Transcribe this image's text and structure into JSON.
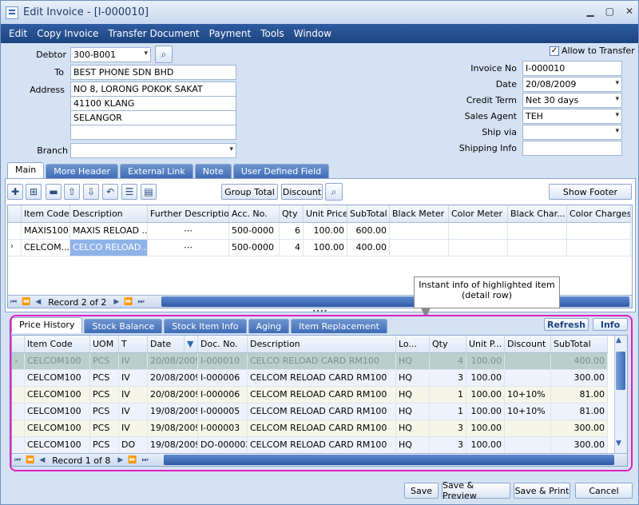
{
  "window": {
    "title": "Edit Invoice - [I-000010]"
  },
  "menu": [
    "Edit",
    "Copy Invoice",
    "Transfer Document",
    "Payment",
    "Tools",
    "Window"
  ],
  "header": {
    "debtor_label": "Debtor",
    "debtor": "300-B001",
    "to_label": "To",
    "to": "BEST PHONE SDN BHD",
    "address_label": "Address",
    "address": [
      "NO 8, LORONG POKOK SAKAT",
      "41100 KLANG",
      "SELANGOR",
      ""
    ],
    "branch_label": "Branch",
    "branch": "",
    "allow_transfer": "Allow to Transfer",
    "invoice_no_label": "Invoice No",
    "invoice_no": "I-000010",
    "date_label": "Date",
    "date": "20/08/2009",
    "credit_term_label": "Credit Term",
    "credit_term": "Net 30 days",
    "sales_agent_label": "Sales Agent",
    "sales_agent": "TEH",
    "ship_via_label": "Ship via",
    "ship_via": "",
    "shipping_info_label": "Shipping Info",
    "shipping_info": ""
  },
  "tabs": [
    "Main",
    "More Header",
    "External Link",
    "Note",
    "User Defined Field"
  ],
  "toolbar": {
    "group_total": "Group Total",
    "discount": "Discount",
    "show_footer": "Show Footer"
  },
  "items_grid": {
    "columns": [
      "Item Code",
      "Description",
      "Further Description",
      "Acc. No.",
      "Qty",
      "Unit Price",
      "SubTotal",
      "Black Meter",
      "Color Meter",
      "Black Char...",
      "Color Charges"
    ],
    "rows": [
      [
        "MAXIS100",
        "MAXIS RELOAD ...",
        "⋯",
        "500-0000",
        "6",
        "100.00",
        "600.00",
        "",
        "",
        "",
        ""
      ],
      [
        "CELCOM...",
        "CELCO  RELOAD...",
        "⋯",
        "500-0000",
        "4",
        "100.00",
        "400.00",
        "",
        "",
        "",
        ""
      ]
    ],
    "record": "Record 2 of 2"
  },
  "callout": "Instant info of highlighted item (detail row)",
  "detail_tabs": [
    "Price History",
    "Stock Balance",
    "Stock Item Info",
    "Aging",
    "Item Replacement"
  ],
  "detail_buttons": {
    "refresh": "Refresh",
    "info": "Info"
  },
  "history_grid": {
    "columns": [
      "Item Code",
      "UOM",
      "T",
      "Date",
      "Doc. No.",
      "Description",
      "Lo...",
      "Qty",
      "Unit P...",
      "Discount",
      "SubTotal"
    ],
    "rows": [
      [
        "CELCOM100",
        "PCS",
        "IV",
        "20/08/2009",
        "I-000010",
        "CELCO  RELOAD CARD RM100",
        "HQ",
        "4",
        "100.00",
        "",
        "400.00"
      ],
      [
        "CELCOM100",
        "PCS",
        "IV",
        "20/08/2009",
        "I-000006",
        "CELCOM RELOAD CARD RM100",
        "HQ",
        "3",
        "100.00",
        "",
        "300.00"
      ],
      [
        "CELCOM100",
        "PCS",
        "IV",
        "20/08/2009",
        "I-000006",
        "CELCOM RELOAD CARD RM100",
        "HQ",
        "1",
        "100.00",
        "10+10%",
        "81.00"
      ],
      [
        "CELCOM100",
        "PCS",
        "IV",
        "19/08/2009",
        "I-000005",
        "CELCOM RELOAD CARD RM100",
        "HQ",
        "1",
        "100.00",
        "10+10%",
        "81.00"
      ],
      [
        "CELCOM100",
        "PCS",
        "IV",
        "19/08/2009",
        "I-000003",
        "CELCOM RELOAD CARD RM100",
        "HQ",
        "3",
        "100.00",
        "",
        "300.00"
      ],
      [
        "CELCOM100",
        "PCS",
        "DO",
        "19/08/2009",
        "DO-000002",
        "CELCOM RELOAD CARD RM100",
        "HQ",
        "3",
        "100.00",
        "",
        "300.00"
      ]
    ],
    "record": "Record 1 of 8"
  },
  "footer": {
    "save": "Save",
    "save_preview": "Save & Preview",
    "save_print": "Save & Print",
    "cancel": "Cancel"
  }
}
